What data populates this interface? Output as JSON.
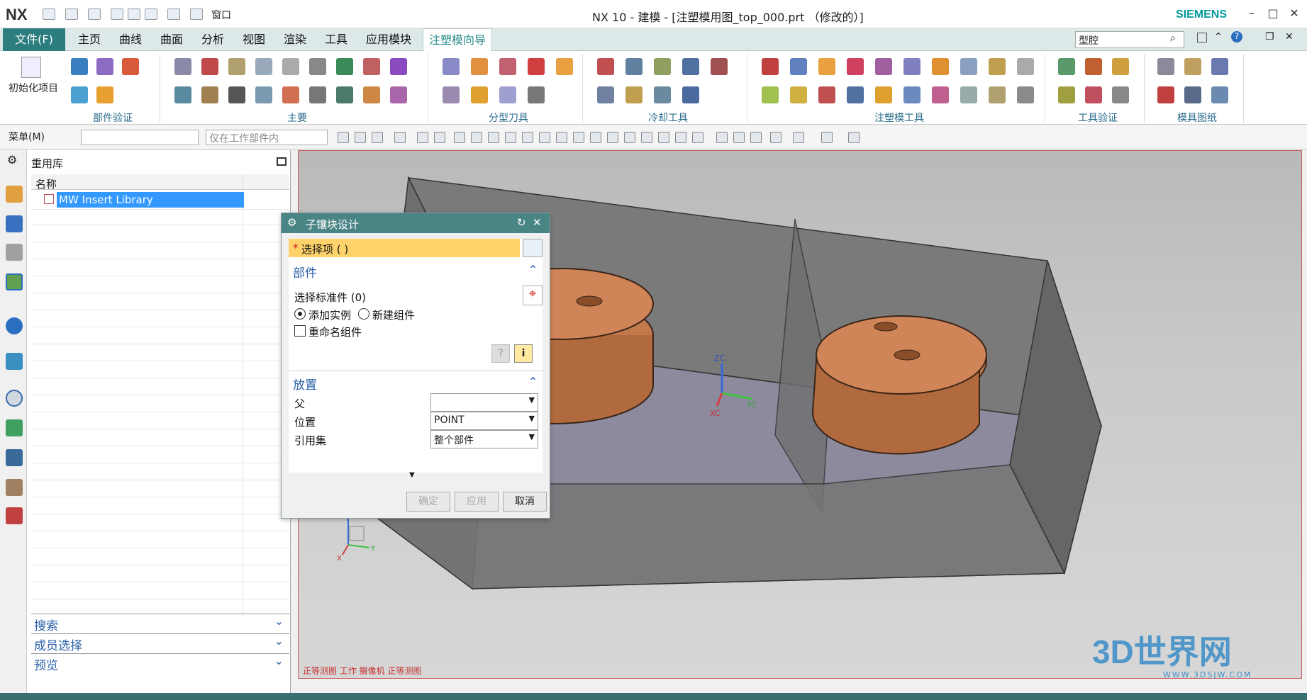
{
  "app": {
    "logo": "NX",
    "window_title": "NX 10 - 建模 - [注塑模用图_top_000.prt （修改的）]",
    "brand": "SIEMENS",
    "window_menu": "窗口",
    "accent": "#2a8b8b"
  },
  "ribbon": {
    "tabs": [
      "文件(F)",
      "主页",
      "曲线",
      "曲面",
      "分析",
      "视图",
      "渲染",
      "工具",
      "应用模块",
      "注塑模向导"
    ],
    "active_tab": "注塑模向导",
    "search_value": "型腔",
    "init_label": "初始化项目",
    "groups": [
      "部件验证",
      "主要",
      "分型刀具",
      "冷却工具",
      "注塑模工具",
      "工具验证",
      "模具图纸"
    ]
  },
  "toolbar": {
    "menu_label": "菜单(M)",
    "filter_placeholder": "",
    "scope_value": "仅在工作部件内"
  },
  "navigator": {
    "title": "重用库",
    "column_name": "名称",
    "tree_item": "MW Insert Library",
    "sections": [
      "搜索",
      "成员选择",
      "预览"
    ]
  },
  "dialog": {
    "title": "子镶块设计",
    "select_item": "选择项 ( )",
    "section_part": "部件",
    "select_std": "选择标准件 (0)",
    "radio_add_instance": "添加实例",
    "radio_new_component": "新建组件",
    "checkbox_rename": "重命名组件",
    "section_place": "放置",
    "parent_label": "父",
    "parent_value": "",
    "position_label": "位置",
    "position_value": "POINT",
    "refset_label": "引用集",
    "refset_value": "整个部件",
    "ok": "确定",
    "apply": "应用",
    "cancel": "取消"
  },
  "viewport": {
    "status": "正等测图 工作 摄像机 正等测图",
    "axis_x": "XC",
    "axis_y": "YC",
    "axis_z": "ZC",
    "triad_z": "Z",
    "triad_y": "Y",
    "triad_x": "X"
  },
  "watermark": {
    "text": "3D世界网",
    "url": "WWW.3DSJW.COM"
  }
}
